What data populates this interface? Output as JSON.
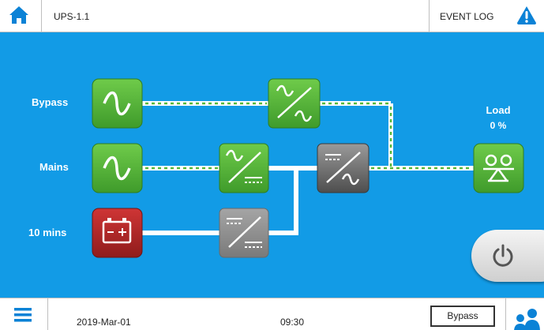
{
  "header": {
    "device_name": "UPS-1.1",
    "event_log_label": "EVENT LOG",
    "icons": {
      "home": "home-icon",
      "alert": "warning-icon"
    }
  },
  "diagram": {
    "bypass_label": "Bypass",
    "mains_label": "Mains",
    "battery_label": "10 mins",
    "load_title": "Load",
    "load_value": "0 %",
    "colors": {
      "background": "#129be6",
      "active_module": "#57b93a",
      "inactive_module": "#8f8f8f",
      "battery_module": "#b52a2a"
    }
  },
  "footer": {
    "date": "2019-Mar-01",
    "time": "09:30",
    "mode": "Bypass",
    "icons": {
      "menu": "menu-icon",
      "user": "user-icon"
    }
  }
}
